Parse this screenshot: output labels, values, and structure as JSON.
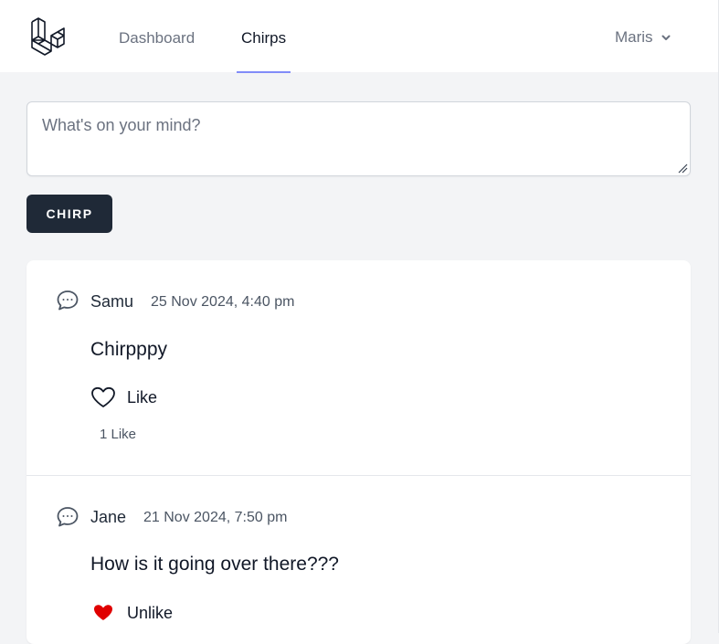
{
  "nav": {
    "links": [
      {
        "label": "Dashboard",
        "active": false
      },
      {
        "label": "Chirps",
        "active": true
      }
    ],
    "user_name": "Maris"
  },
  "composer": {
    "placeholder": "What's on your mind?",
    "value": "",
    "submit_label": "CHIRP"
  },
  "chirps": [
    {
      "author": "Samu",
      "timestamp": "25 Nov 2024, 4:40 pm",
      "message": "Chirpppy",
      "like_label": "Like",
      "liked": false,
      "like_count_text": "1 Like"
    },
    {
      "author": "Jane",
      "timestamp": "21 Nov 2024, 7:50 pm",
      "message": "How is it going over there???",
      "like_label": "Unlike",
      "liked": true
    }
  ],
  "colors": {
    "liked_heart": "#e00000",
    "button_dark": "#1f2937",
    "active_underline": "#818cf8"
  }
}
